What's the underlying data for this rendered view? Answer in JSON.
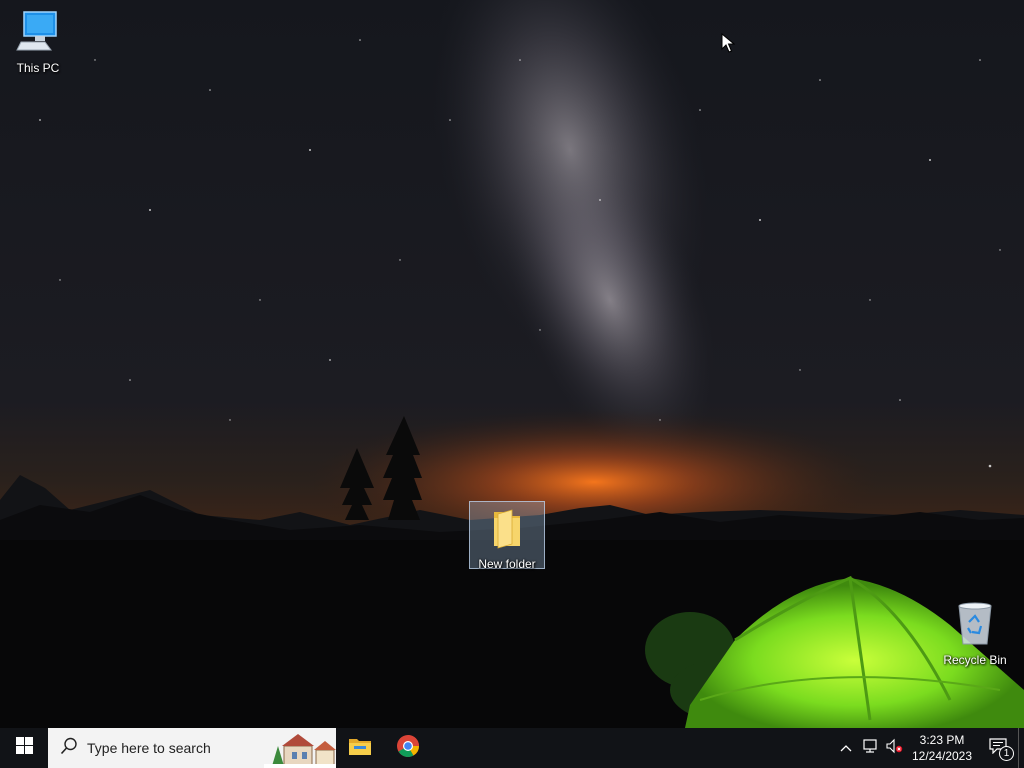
{
  "desktop": {
    "icons": [
      {
        "id": "this-pc",
        "label": "This PC",
        "icon": "computer-icon"
      },
      {
        "id": "new-folder",
        "label": "New folder",
        "icon": "folder-icon",
        "selected": true
      },
      {
        "id": "recycle-bin",
        "label": "Recycle Bin",
        "icon": "recycle-bin-icon"
      }
    ],
    "wallpaper": "night-sky-milky-way-green-tent"
  },
  "taskbar": {
    "start_icon": "windows-logo-icon",
    "search": {
      "placeholder": "Type here to search",
      "icon": "search-icon",
      "highlight": "christmas-village-illustration"
    },
    "pinned": [
      {
        "name": "File Explorer",
        "icon": "file-explorer-icon"
      },
      {
        "name": "Google Chrome",
        "icon": "chrome-icon"
      }
    ],
    "tray": {
      "icons": [
        "chevron-up-icon",
        "network-icon",
        "speaker-muted-icon"
      ],
      "time": "3:23 PM",
      "date": "12/24/2023",
      "notification_count": "1"
    }
  },
  "colors": {
    "taskbar": "#111317",
    "search_box": "#f3f3f3",
    "tent_green": "#7bdc1f",
    "horizon_glow": "#e8631a"
  }
}
